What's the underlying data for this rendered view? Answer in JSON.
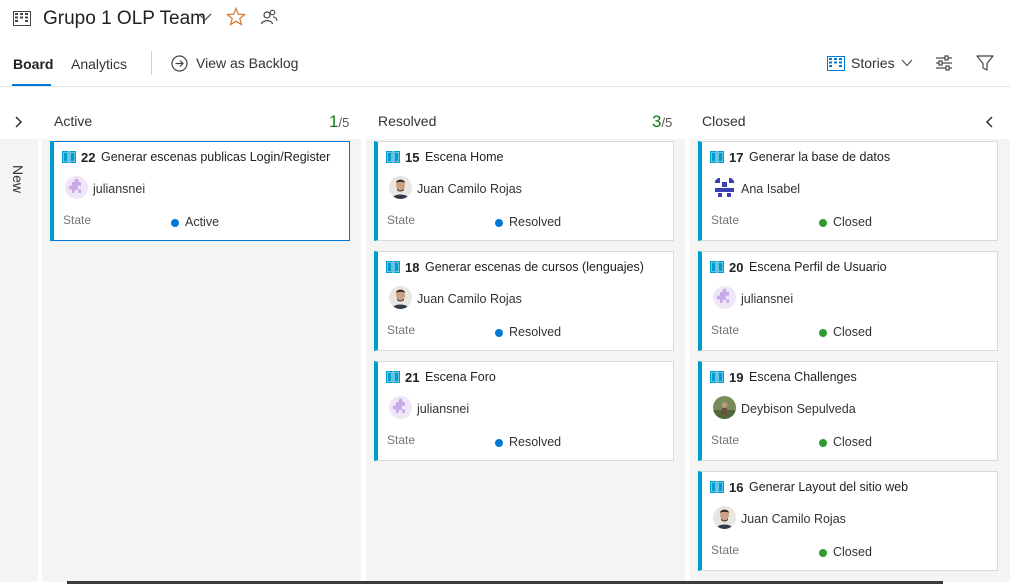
{
  "header": {
    "team_title": "Grupo 1 OLP Team"
  },
  "toolbar": {
    "tabs": [
      {
        "label": "Board",
        "active": true
      },
      {
        "label": "Analytics",
        "active": false
      }
    ],
    "view_backlog_label": "View as Backlog",
    "backlog_level": "Stories"
  },
  "board": {
    "new_column_label": "New",
    "columns": [
      {
        "name": "Active",
        "count": "1",
        "limit": "/5",
        "cards": [
          {
            "id": "22",
            "title": "Generar escenas publicas Login/Register",
            "assignee": "juliansnei",
            "avatar": "puzzle",
            "state_label": "State",
            "state": "Active"
          }
        ]
      },
      {
        "name": "Resolved",
        "count": "3",
        "limit": "/5",
        "cards": [
          {
            "id": "15",
            "title": "Escena Home",
            "assignee": "Juan Camilo Rojas",
            "avatar": "photo-man",
            "state_label": "State",
            "state": "Resolved"
          },
          {
            "id": "18",
            "title": "Generar escenas de cursos (lenguajes)",
            "assignee": "Juan Camilo Rojas",
            "avatar": "photo-man",
            "state_label": "State",
            "state": "Resolved"
          },
          {
            "id": "21",
            "title": "Escena Foro",
            "assignee": "juliansnei",
            "avatar": "puzzle",
            "state_label": "State",
            "state": "Resolved"
          }
        ]
      },
      {
        "name": "Closed",
        "count": "",
        "limit": "",
        "cards": [
          {
            "id": "17",
            "title": "Generar la base de datos",
            "assignee": "Ana Isabel",
            "avatar": "pattern",
            "state_label": "State",
            "state": "Closed"
          },
          {
            "id": "20",
            "title": "Escena Perfil de Usuario",
            "assignee": "juliansnei",
            "avatar": "puzzle",
            "state_label": "State",
            "state": "Closed"
          },
          {
            "id": "19",
            "title": "Escena Challenges",
            "assignee": "Deybison Sepulveda",
            "avatar": "photo-outdoor",
            "state_label": "State",
            "state": "Closed"
          },
          {
            "id": "16",
            "title": "Generar Layout del sitio web",
            "assignee": "Juan Camilo Rojas",
            "avatar": "photo-man",
            "state_label": "State",
            "state": "Closed"
          }
        ]
      }
    ]
  },
  "colors": {
    "accent": "#0078d4",
    "story_bar": "#009ccc",
    "state_active": "#0078d4",
    "state_resolved": "#0078d4",
    "state_closed": "#339933",
    "count_ok": "#107c10"
  }
}
